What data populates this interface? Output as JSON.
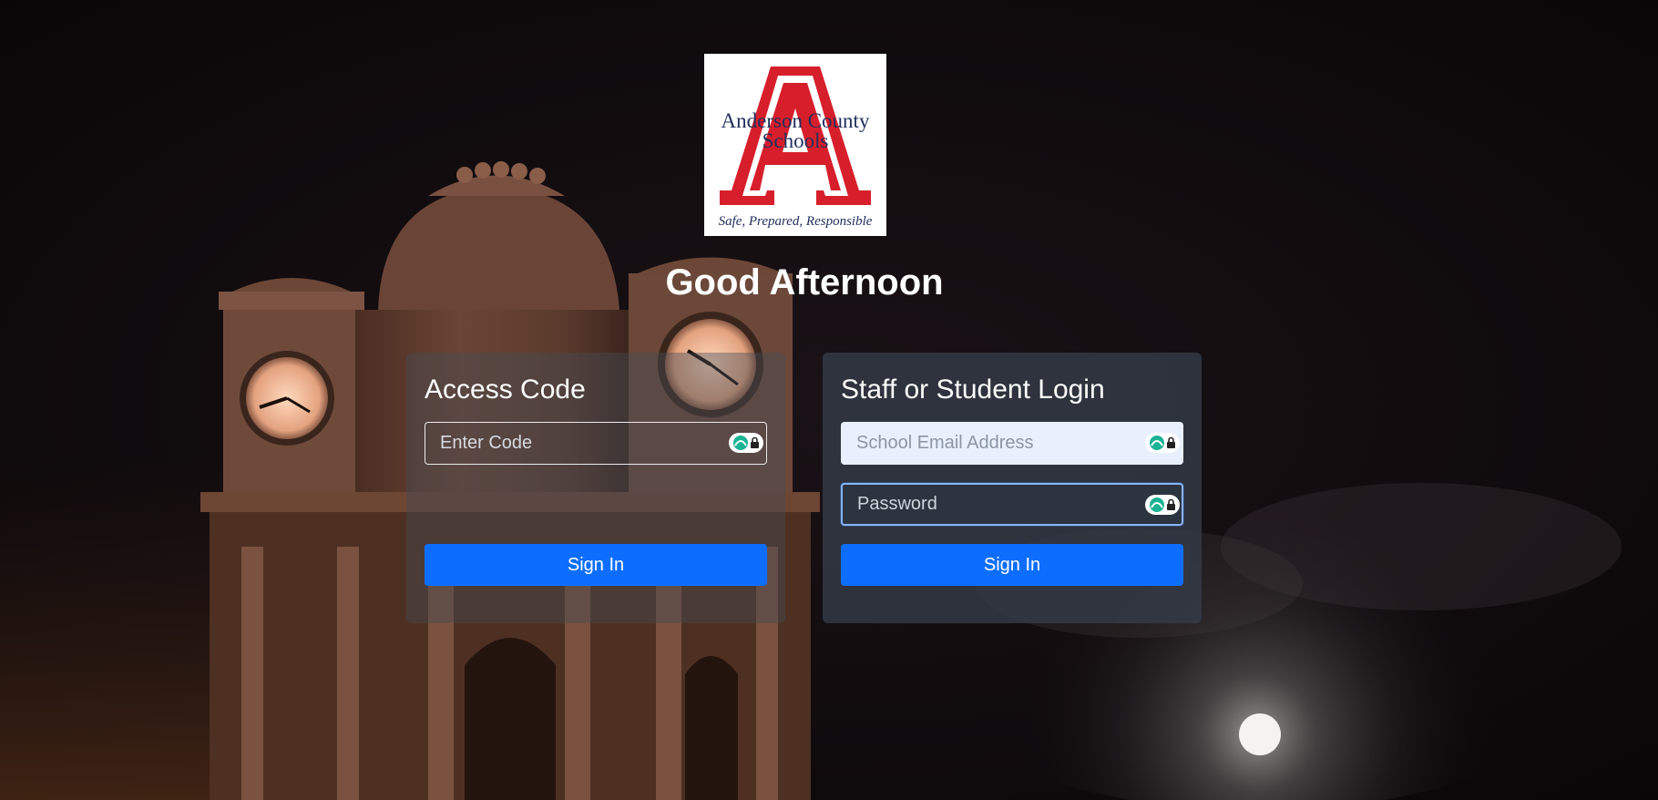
{
  "logo": {
    "name_line1": "Anderson County",
    "name_line2": "Schools",
    "letter": "A",
    "motto": "Safe, Prepared, Responsible"
  },
  "greeting": "Good Afternoon",
  "access_panel": {
    "title": "Access Code",
    "code_placeholder": "Enter Code",
    "sign_in_label": "Sign In"
  },
  "staff_panel": {
    "title": "Staff or Student Login",
    "email_placeholder": "School Email Address",
    "password_placeholder": "Password",
    "sign_in_label": "Sign In"
  },
  "icons": {
    "field_badge": "password-manager-icon"
  },
  "colors": {
    "primary_button": "#0d6efd",
    "logo_red": "#d71f2b",
    "logo_navy": "#1f2f5c",
    "text": "#ffffff"
  }
}
